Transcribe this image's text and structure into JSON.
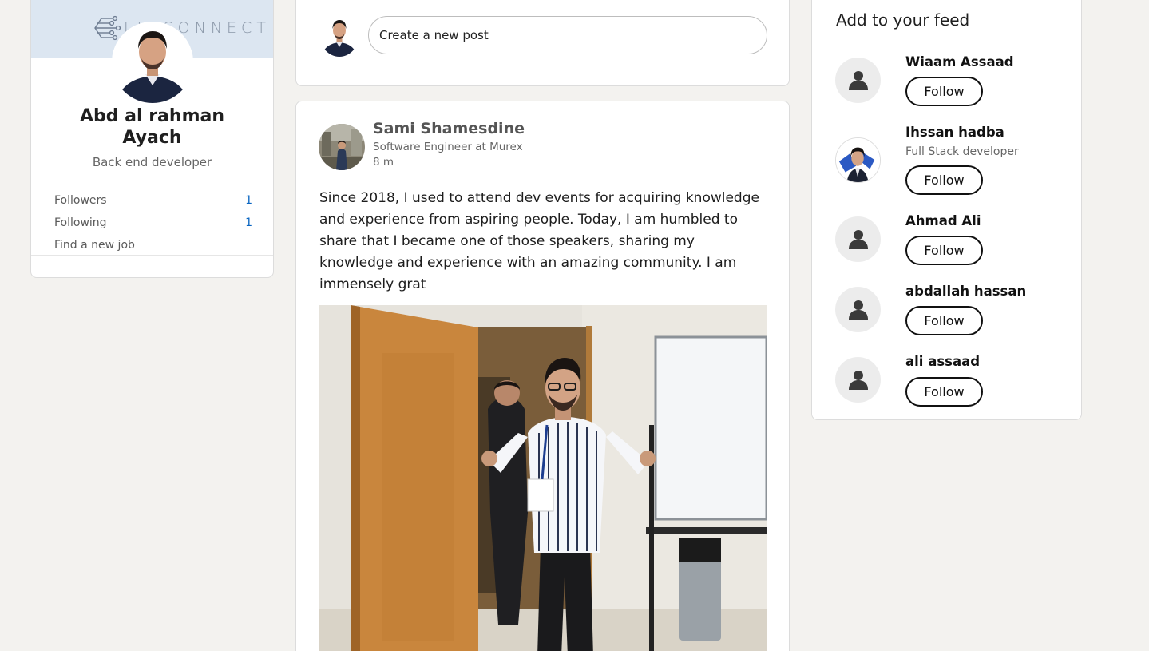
{
  "profile": {
    "banner_logo_text": "LINCONNECT",
    "name_line1": "Abd al rahman",
    "name_line2": "Ayach",
    "title": "Back end developer",
    "stats": [
      {
        "label": "Followers",
        "count": "1"
      },
      {
        "label": "Following",
        "count": "1"
      }
    ],
    "find_job_label": "Find a new job"
  },
  "composer": {
    "placeholder": "Create a new post"
  },
  "post": {
    "author": "Sami Shamesdine",
    "subtitle": "Software Engineer at Murex",
    "time": "8 m",
    "text": "Since 2018, I used to attend dev events for acquiring knowledge and experience from aspiring people. Today, I am humbled to share that I became one of those speakers, sharing my knowledge and experience with an amazing community. I am immensely grat"
  },
  "feed": {
    "title": "Add to your feed",
    "follow_label": "Follow",
    "suggestions": [
      {
        "name": "Wiaam Assaad",
        "subtitle": "",
        "avatar": "default-user-icon"
      },
      {
        "name": "Ihssan hadba",
        "subtitle": "Full Stack developer",
        "avatar": "photo"
      },
      {
        "name": "Ahmad Ali",
        "subtitle": "",
        "avatar": "default-user-icon"
      },
      {
        "name": "abdallah hassan",
        "subtitle": "",
        "avatar": "default-user-icon"
      },
      {
        "name": "ali assaad",
        "subtitle": "",
        "avatar": "default-user-icon"
      }
    ]
  },
  "colors": {
    "background": "#f3f2ef",
    "link_blue": "#0a66c2",
    "banner": "#dce6f1"
  }
}
